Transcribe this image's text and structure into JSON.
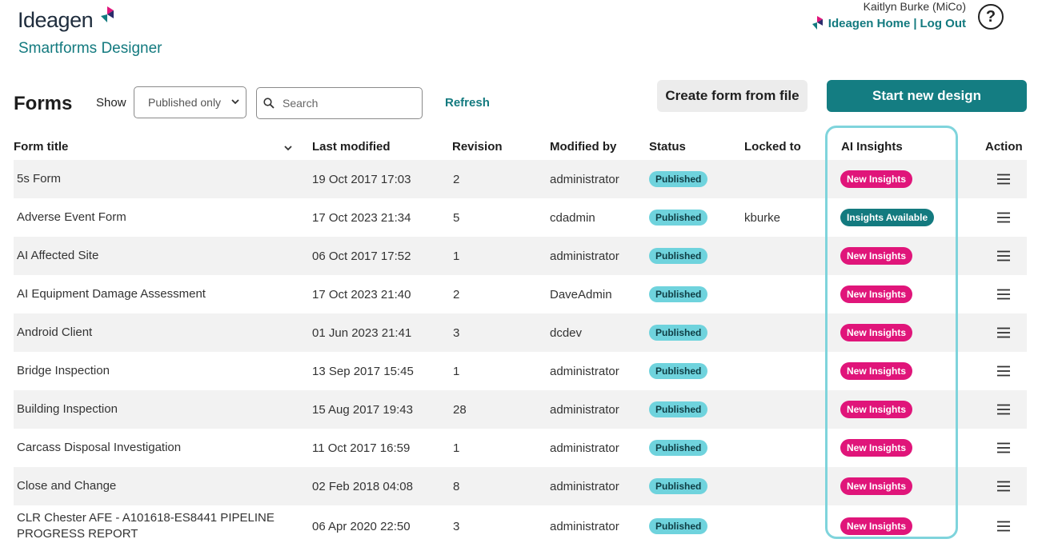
{
  "header": {
    "logo_text": "Ideagen",
    "product_name": "Smartforms Designer",
    "user_name": "Kaitlyn Burke (MiCo)",
    "home_link": "Ideagen Home",
    "separator": "|",
    "logout_link": "Log Out",
    "help_label": "?"
  },
  "toolbar": {
    "title": "Forms",
    "show_label": "Show",
    "filter_value": "Published only",
    "search_placeholder": "Search",
    "search_value": "",
    "refresh_label": "Refresh",
    "create_from_file_label": "Create form from file",
    "start_new_label": "Start new design"
  },
  "columns": {
    "form_title": "Form title",
    "last_modified": "Last modified",
    "revision": "Revision",
    "modified_by": "Modified by",
    "status": "Status",
    "locked_to": "Locked to",
    "ai_insights": "AI Insights",
    "action": "Action"
  },
  "rows": [
    {
      "title": "5s Form",
      "modified": "19 Oct 2017 17:03",
      "revision": "2",
      "modified_by": "administrator",
      "status": "Published",
      "locked_to": "",
      "insight": "New Insights",
      "insight_type": "new"
    },
    {
      "title": "Adverse Event Form",
      "modified": "17 Oct 2023 21:34",
      "revision": "5",
      "modified_by": "cdadmin",
      "status": "Published",
      "locked_to": "kburke",
      "insight": "Insights Available",
      "insight_type": "available"
    },
    {
      "title": "AI Affected Site",
      "modified": "06 Oct 2017 17:52",
      "revision": "1",
      "modified_by": "administrator",
      "status": "Published",
      "locked_to": "",
      "insight": "New Insights",
      "insight_type": "new"
    },
    {
      "title": "AI Equipment Damage Assessment",
      "modified": "17 Oct 2023 21:40",
      "revision": "2",
      "modified_by": "DaveAdmin",
      "status": "Published",
      "locked_to": "",
      "insight": "New Insights",
      "insight_type": "new"
    },
    {
      "title": "Android Client",
      "modified": "01 Jun 2023 21:41",
      "revision": "3",
      "modified_by": "dcdev",
      "status": "Published",
      "locked_to": "",
      "insight": "New Insights",
      "insight_type": "new"
    },
    {
      "title": "Bridge Inspection",
      "modified": "13 Sep 2017 15:45",
      "revision": "1",
      "modified_by": "administrator",
      "status": "Published",
      "locked_to": "",
      "insight": "New Insights",
      "insight_type": "new"
    },
    {
      "title": "Building Inspection",
      "modified": "15 Aug 2017 19:43",
      "revision": "28",
      "modified_by": "administrator",
      "status": "Published",
      "locked_to": "",
      "insight": "New Insights",
      "insight_type": "new"
    },
    {
      "title": "Carcass Disposal Investigation",
      "modified": "11 Oct 2017 16:59",
      "revision": "1",
      "modified_by": "administrator",
      "status": "Published",
      "locked_to": "",
      "insight": "New Insights",
      "insight_type": "new"
    },
    {
      "title": "Close and Change",
      "modified": "02 Feb 2018 04:08",
      "revision": "8",
      "modified_by": "administrator",
      "status": "Published",
      "locked_to": "",
      "insight": "New Insights",
      "insight_type": "new"
    },
    {
      "title": "CLR Chester AFE - A101618-ES8441 PIPELINE PROGRESS REPORT",
      "modified": "06 Apr 2020 22:50",
      "revision": "3",
      "modified_by": "administrator",
      "status": "Published",
      "locked_to": "",
      "insight": "New Insights",
      "insight_type": "new"
    }
  ],
  "colors": {
    "brand_teal": "#137a7f",
    "published_badge": "#6fd3dd",
    "new_insights_badge": "#e0157a",
    "insights_available_badge": "#137a7f",
    "highlight_outline": "#7fd4dc"
  },
  "icons": {
    "logo_mark": "ideagen-mark-icon",
    "help": "help-circle-icon",
    "search": "search-icon",
    "dropdown": "chevron-down-icon",
    "row_action": "hamburger-menu-icon"
  }
}
